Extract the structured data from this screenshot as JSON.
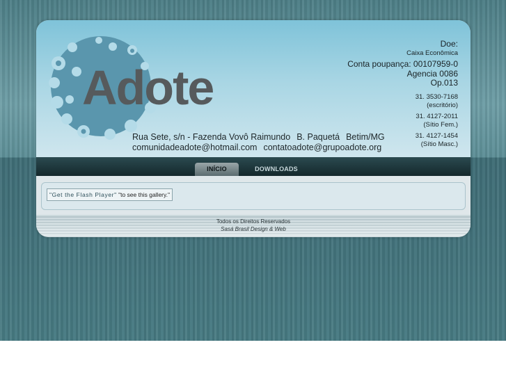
{
  "brand": {
    "logo_text": "Adote"
  },
  "header": {
    "address_line1": [
      "Rua Sete, s/n - Fazenda Vovô Raimundo",
      "B. Paquetá",
      "Betim/MG"
    ],
    "address_line2": [
      "comunidadeadote@hotmail.com",
      "contatoadote@grupoadote.org"
    ],
    "donate": {
      "title": "Doe:",
      "bank": "Caixa Econômica",
      "account": "Conta poupança: 00107959-0",
      "agency": "Agencia 0086",
      "op": "Op.013"
    },
    "phones": [
      {
        "number": "31. 3530-7168",
        "label": "(escritório)"
      },
      {
        "number": "31. 4127-2011",
        "label": "(Sítio Fem.)"
      },
      {
        "number": "31. 4127-1454",
        "label": "(Sítio Masc.)"
      }
    ]
  },
  "nav": {
    "tabs": [
      {
        "label": "INÍCIO",
        "active": true
      },
      {
        "label": "DOWNLOADS",
        "active": false
      }
    ]
  },
  "content": {
    "flash_link": "\"Get the Flash Player\"",
    "flash_suffix": "\"to see this gallery.\""
  },
  "footer": {
    "rights": "Todos os Direitos Reservados",
    "credit": "Sasá Brasil Design & Web"
  },
  "colors": {
    "logo_circle": "#5a96ad",
    "logo_text": "#565a5c",
    "nav_bg": "#1b3236"
  }
}
